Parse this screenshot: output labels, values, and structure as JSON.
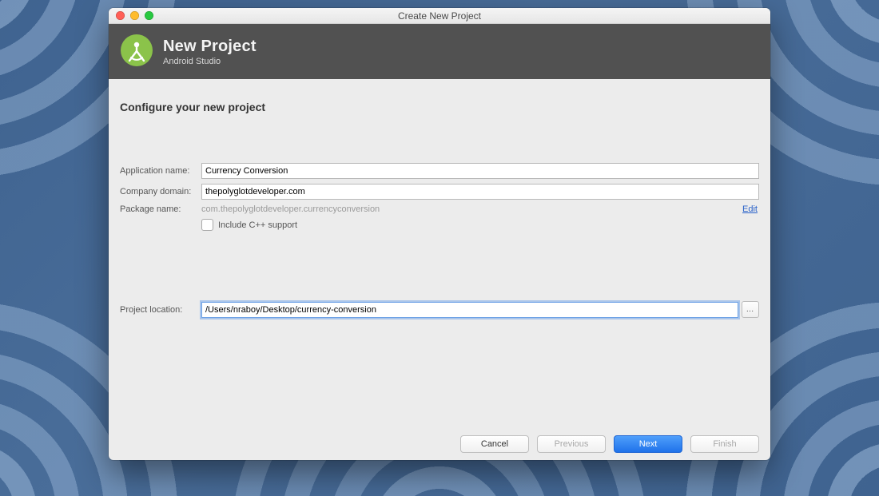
{
  "window": {
    "title": "Create New Project"
  },
  "header": {
    "title": "New Project",
    "subtitle": "Android Studio"
  },
  "section_title": "Configure your new project",
  "form": {
    "app_name_label": "Application name:",
    "app_name_value": "Currency Conversion",
    "company_domain_label": "Company domain:",
    "company_domain_value": "thepolyglotdeveloper.com",
    "package_name_label": "Package name:",
    "package_name_value": "com.thepolyglotdeveloper.currencyconversion",
    "edit_link": "Edit",
    "cpp_checkbox_label": "Include C++ support",
    "cpp_checked": false,
    "project_location_label": "Project location:",
    "project_location_value": "/Users/nraboy/Desktop/currency-conversion",
    "browse_label": "…"
  },
  "footer": {
    "cancel": "Cancel",
    "previous": "Previous",
    "next": "Next",
    "finish": "Finish"
  }
}
